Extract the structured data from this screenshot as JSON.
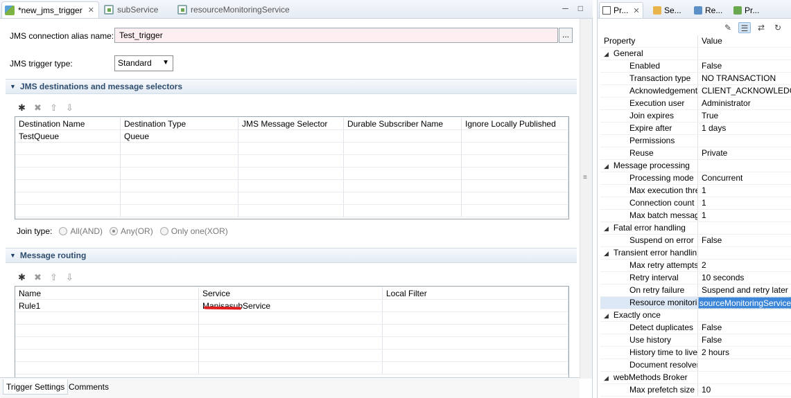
{
  "editor": {
    "tabs": [
      {
        "label": "*new_jms_trigger",
        "active": true,
        "icon": "trigger-icon"
      },
      {
        "label": "subService",
        "active": false,
        "icon": "flow-service-icon"
      },
      {
        "label": "resourceMonitoringService",
        "active": false,
        "icon": "flow-service-icon"
      }
    ],
    "minimize_glyph": "─",
    "maximize_glyph": "□",
    "close_glyph": "✕",
    "connection_alias_label": "JMS connection alias name:",
    "connection_alias_value": "Test_trigger",
    "browse_label": "...",
    "trigger_type_label": "JMS trigger type:",
    "trigger_type_value": "Standard",
    "destinations_section": "JMS destinations and message selectors",
    "destinations_columns": [
      "Destination Name",
      "Destination Type",
      "JMS Message Selector",
      "Durable Subscriber Name",
      "Ignore Locally Published"
    ],
    "destinations_rows": [
      [
        "TestQueue",
        "Queue",
        "",
        "",
        ""
      ]
    ],
    "join_type_label": "Join type:",
    "join_options": [
      {
        "label": "All(AND)",
        "selected": false
      },
      {
        "label": "Any(OR)",
        "selected": true
      },
      {
        "label": "Only one(XOR)",
        "selected": false
      }
    ],
    "routing_section": "Message routing",
    "routing_columns": [
      "Name",
      "Service",
      "Local Filter"
    ],
    "routing_rows": [
      [
        "Rule1",
        "ManisasubService",
        ""
      ]
    ],
    "bottom_tabs": [
      "Trigger Settings",
      "Comments"
    ]
  },
  "properties": {
    "tabs": [
      "Pr...",
      "Se...",
      "Re...",
      "Pr..."
    ],
    "columns": [
      "Property",
      "Value"
    ],
    "rows": [
      {
        "type": "category",
        "key": "General"
      },
      {
        "type": "item",
        "key": "Enabled",
        "value": "False"
      },
      {
        "type": "item",
        "key": "Transaction type",
        "value": "NO TRANSACTION"
      },
      {
        "type": "item",
        "key": "Acknowledgement",
        "value": "CLIENT_ACKNOWLEDGE"
      },
      {
        "type": "item",
        "key": "Execution user",
        "value": "Administrator"
      },
      {
        "type": "item",
        "key": "Join expires",
        "value": "True"
      },
      {
        "type": "item",
        "key": "Expire after",
        "value": "1 days"
      },
      {
        "type": "item",
        "key": "Permissions",
        "value": ""
      },
      {
        "type": "item",
        "key": "Reuse",
        "value": "Private"
      },
      {
        "type": "category",
        "key": "Message processing"
      },
      {
        "type": "item",
        "key": "Processing mode",
        "value": "Concurrent"
      },
      {
        "type": "item",
        "key": "Max execution thre",
        "value": "1"
      },
      {
        "type": "item",
        "key": "Connection count",
        "value": "1"
      },
      {
        "type": "item",
        "key": "Max batch messag",
        "value": "1"
      },
      {
        "type": "category",
        "key": "Fatal error handling"
      },
      {
        "type": "item",
        "key": "Suspend on error",
        "value": "False"
      },
      {
        "type": "category",
        "key": "Transient error handlin"
      },
      {
        "type": "item",
        "key": "Max retry attempts",
        "value": "2"
      },
      {
        "type": "item",
        "key": "Retry interval",
        "value": "10 seconds"
      },
      {
        "type": "item",
        "key": "On retry failure",
        "value": "Suspend and retry later"
      },
      {
        "type": "item",
        "key": "Resource monitori",
        "value": "sourceMonitoringService",
        "selected": true
      },
      {
        "type": "category",
        "key": "Exactly once"
      },
      {
        "type": "item",
        "key": "Detect duplicates",
        "value": "False"
      },
      {
        "type": "item",
        "key": "Use history",
        "value": "False"
      },
      {
        "type": "item",
        "key": "History time to live",
        "value": "2 hours"
      },
      {
        "type": "item",
        "key": "Document resolver",
        "value": ""
      },
      {
        "type": "category",
        "key": "webMethods Broker"
      },
      {
        "type": "item",
        "key": "Max prefetch size",
        "value": "10"
      }
    ]
  },
  "colors": {
    "section_text": "#2e4d6f",
    "alias_field_bg": "#fdeef1",
    "selected_value_bg": "#3b86d8",
    "redaction_mark": "#e01d1d"
  }
}
